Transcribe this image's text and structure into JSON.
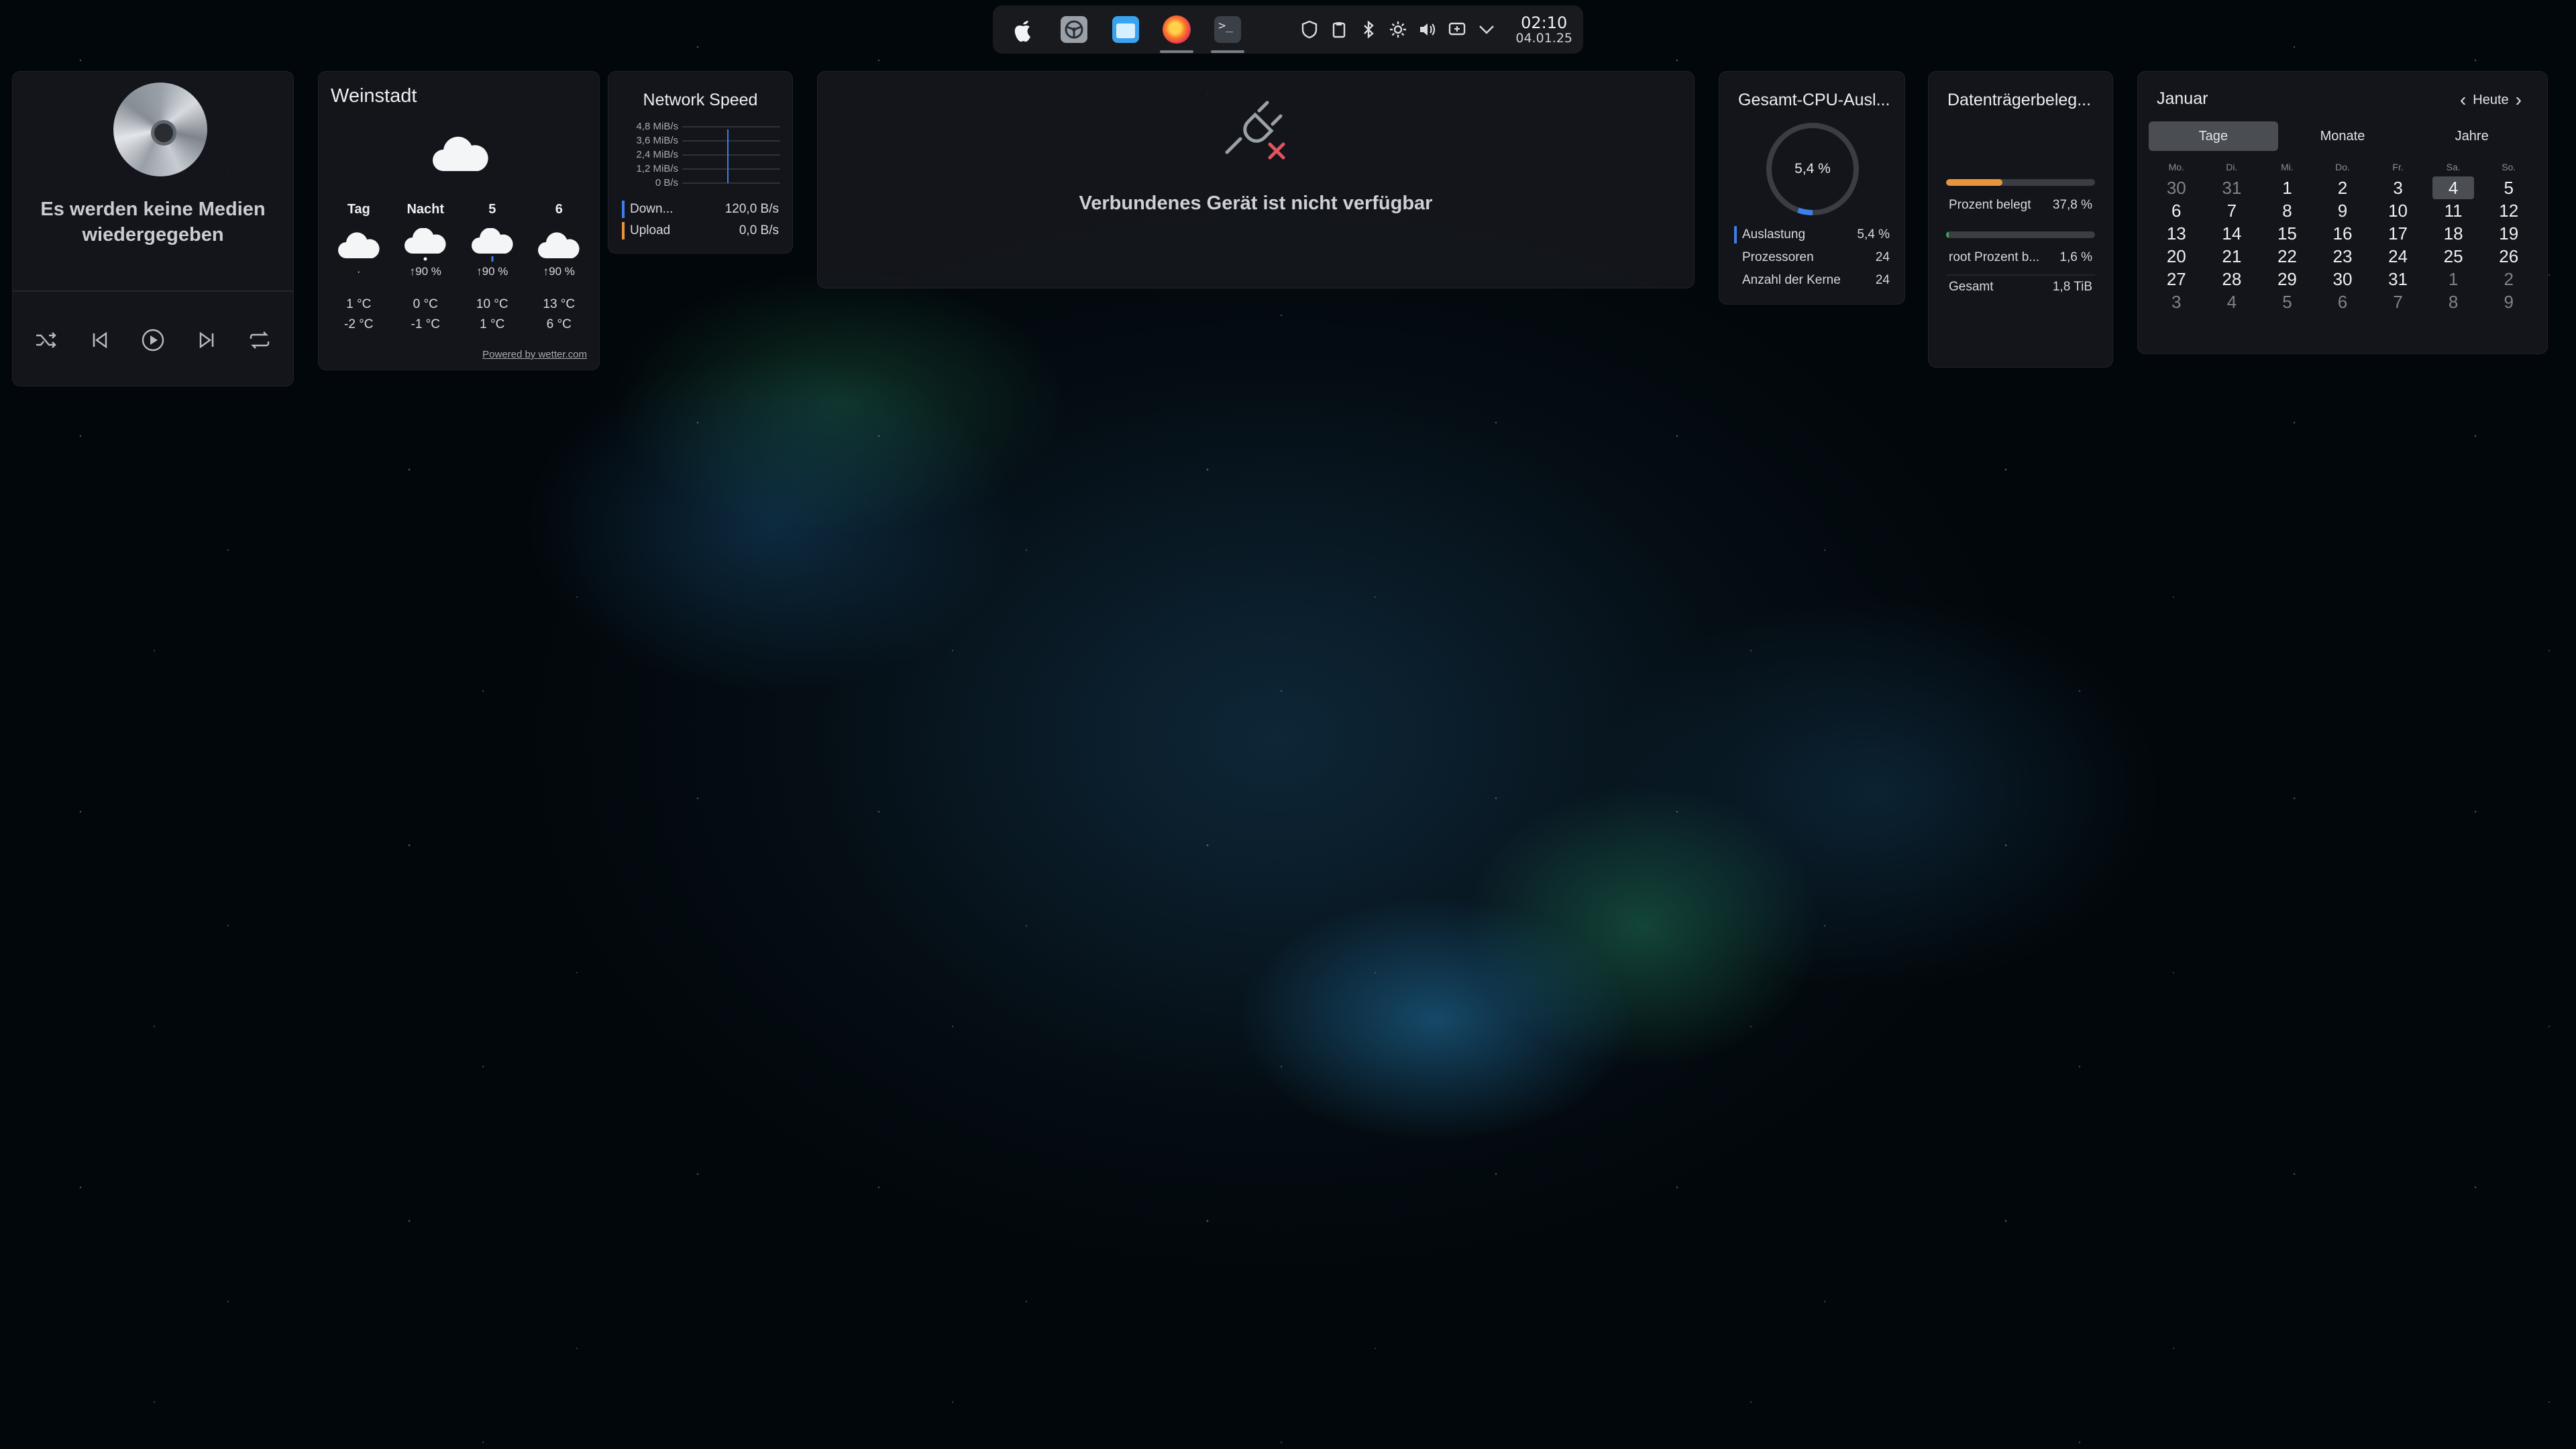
{
  "taskbar": {
    "apps": [
      {
        "name": "apple-launcher-icon"
      },
      {
        "name": "steering-wheel-app-icon"
      },
      {
        "name": "file-manager-icon"
      },
      {
        "name": "firefox-icon"
      },
      {
        "name": "terminal-icon"
      }
    ],
    "clock_time": "02:10",
    "clock_date": "04.01.25"
  },
  "media": {
    "no_media_text": "Es werden keine Medien wiedergegeben"
  },
  "weather": {
    "city": "Weinstadt",
    "days": [
      {
        "label": "Tag",
        "precip": "·",
        "high": "1 °C",
        "low": "-2 °C"
      },
      {
        "label": "Nacht",
        "precip": "90 %",
        "high": "0 °C",
        "low": "-1 °C"
      },
      {
        "label": "5",
        "precip": "90 %",
        "high": "10 °C",
        "low": "1 °C"
      },
      {
        "label": "6",
        "precip": "90 %",
        "high": "13 °C",
        "low": "6 °C"
      }
    ],
    "powered_by": "Powered by wetter.com"
  },
  "network": {
    "title": "Network Speed",
    "axis_labels": [
      "4,8 MiB/s",
      "3,6 MiB/s",
      "2,4 MiB/s",
      "1,2 MiB/s",
      "0 B/s"
    ],
    "download_label": "Down...",
    "download_value": "120,0 B/s",
    "upload_label": "Upload",
    "upload_value": "0,0 B/s",
    "download_color": "#3d7ee8",
    "upload_color": "#e8943d"
  },
  "device": {
    "message": "Verbundenes Gerät ist nicht verfügbar"
  },
  "cpu": {
    "title": "Gesamt-CPU-Ausl...",
    "value_text": "5,4 %",
    "usage_fraction": 0.054,
    "rows": [
      {
        "label": "Auslastung",
        "value": "5,4 %"
      },
      {
        "label": "Prozessoren",
        "value": "24"
      },
      {
        "label": "Anzahl der Kerne",
        "value": "24"
      }
    ]
  },
  "disk": {
    "title": "Datenträgerbeleg...",
    "used_fraction": 0.378,
    "root_fraction": 0.016,
    "used_label": "Prozent belegt",
    "used_value": "37,8 %",
    "root_label": "root Prozent b...",
    "root_value": "1,6 %",
    "total_label": "Gesamt",
    "total_value": "1,8 TiB",
    "used_color": "#e8943d",
    "root_color": "#3fa34d"
  },
  "calendar": {
    "month": "Januar",
    "today_label": "Heute",
    "tabs": [
      "Tage",
      "Monate",
      "Jahre"
    ],
    "weekdays": [
      "Mo.",
      "Di.",
      "Mi.",
      "Do.",
      "Fr.",
      "Sa.",
      "So."
    ],
    "days": [
      "30",
      "31",
      "1",
      "2",
      "3",
      "4",
      "5",
      "6",
      "7",
      "8",
      "9",
      "10",
      "11",
      "12",
      "13",
      "14",
      "15",
      "16",
      "17",
      "18",
      "19",
      "20",
      "21",
      "22",
      "23",
      "24",
      "25",
      "26",
      "27",
      "28",
      "29",
      "30",
      "31",
      "1",
      "2",
      "3",
      "4",
      "5",
      "6",
      "7",
      "8",
      "9"
    ]
  }
}
